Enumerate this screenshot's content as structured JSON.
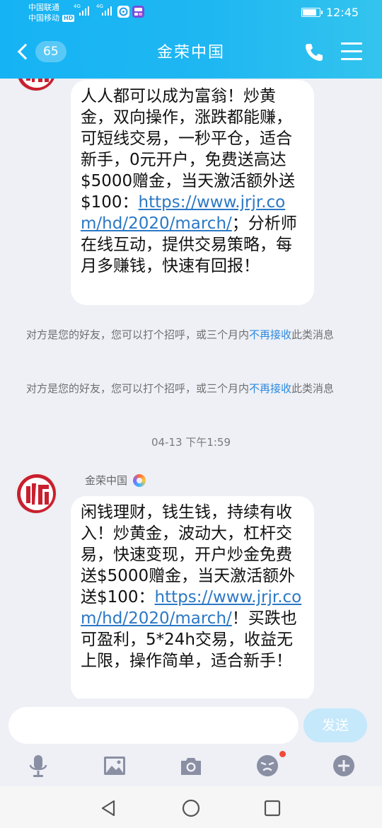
{
  "status_bar": {
    "carrier_1": "中国联通",
    "carrier_2": "中国移动",
    "hd_badge": "HD",
    "net_1": "4G",
    "net_2": "4G",
    "time": "12:45",
    "battery_level": 0.85,
    "icons": [
      "signal-icon",
      "signal-icon",
      "browser-app-icon",
      "notification-app-icon",
      "battery-icon"
    ]
  },
  "header": {
    "unread_count": "65",
    "title": "金荣中国",
    "icons": [
      "back-chevron-icon",
      "phone-icon",
      "menu-icon"
    ]
  },
  "messages": [
    {
      "text_before": "人人都可以成为富翁！炒黄金，双向操作，涨跌都能赚，可短线交易，一秒平仓，适合新手，0元开户，免费送高达$5000赠金，当天激活额外送$100：",
      "link": "https://www.jrjr.com/hd/2020/march/",
      "text_after": "；分析师在线互动，提供交易策略，每月多赚钱，快速有回报！"
    },
    {
      "sender": "金荣中国",
      "text_before": "闲钱理财，钱生钱，持续有收入！炒黄金，波动大，杠杆交易，快速变现，开户炒金免费送$5000赠金，当天激活额外送$100：",
      "link": "https://www.jrjr.com/hd/2020/march/",
      "text_after": "！买跌也可盈利，5*24h交易，收益无上限，操作简单，适合新手！"
    }
  ],
  "notices": [
    {
      "text": "对方是您的好友，您可以打个招呼，或三个月内",
      "link": "不再接收",
      "tail": "此类消息"
    },
    {
      "text": "对方是您的好友，您可以打个招呼，或三个月内",
      "link": "不再接收",
      "tail": "此类消息"
    }
  ],
  "timestamp": "04-13 下午1:59",
  "input": {
    "placeholder": "",
    "value": "",
    "send_label": "发送"
  },
  "toolbar": [
    "microphone-icon",
    "image-icon",
    "camera-icon",
    "emoji-icon",
    "plus-icon"
  ],
  "nav": [
    "back-triangle-icon",
    "home-circle-icon",
    "recents-square-icon"
  ],
  "colors": {
    "header_start": "#16b3f4",
    "header_end": "#33c4ee",
    "link": "#2b78c5",
    "notice_link": "#2d88dc",
    "logo_red": "#c8202f",
    "send_disabled": "#c5e8fb"
  }
}
